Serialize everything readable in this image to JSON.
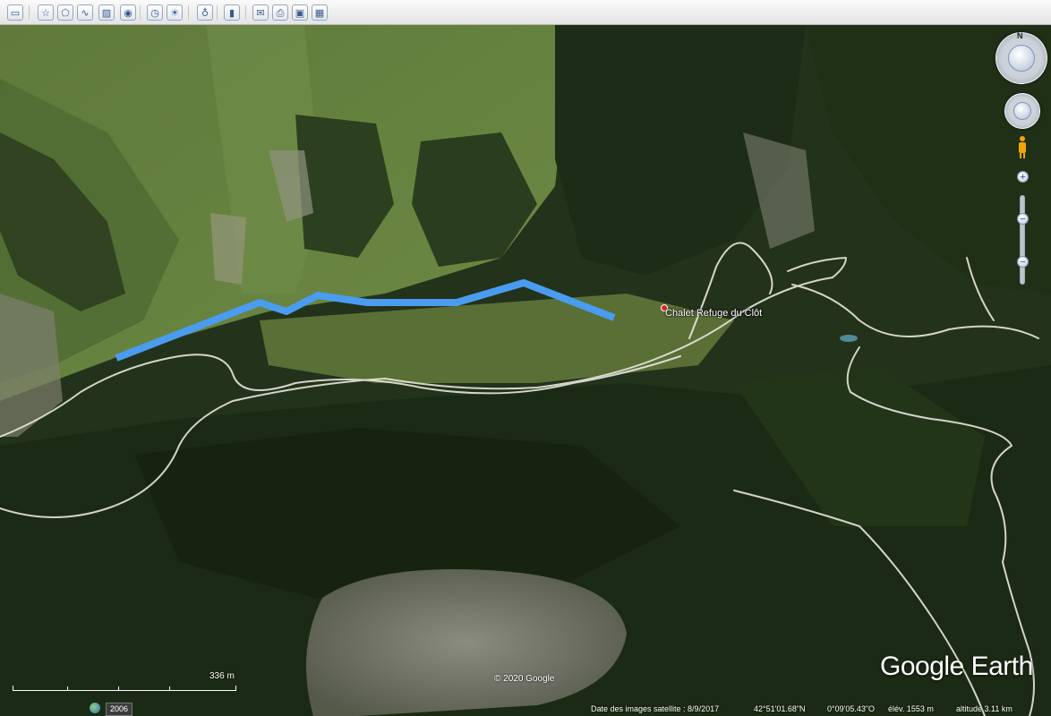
{
  "toolbar": {
    "buttons": [
      {
        "name": "sidebar-toggle-icon",
        "glyph": "▭"
      },
      {
        "name": "add-placemark-icon",
        "glyph": "☆"
      },
      {
        "name": "add-polygon-icon",
        "glyph": "⬠"
      },
      {
        "name": "add-path-icon",
        "glyph": "∿"
      },
      {
        "name": "add-image-overlay-icon",
        "glyph": "▨"
      },
      {
        "name": "record-tour-icon",
        "glyph": "◉"
      },
      {
        "name": "historical-imagery-icon",
        "glyph": "◷"
      },
      {
        "name": "sunlight-icon",
        "glyph": "☀"
      },
      {
        "name": "switch-to-sky-icon",
        "glyph": "♁"
      },
      {
        "name": "ruler-icon",
        "glyph": "▮"
      },
      {
        "name": "email-icon",
        "glyph": "✉"
      },
      {
        "name": "print-icon",
        "glyph": "⎙"
      },
      {
        "name": "save-image-icon",
        "glyph": "▣"
      },
      {
        "name": "view-in-maps-icon",
        "glyph": "▦"
      }
    ]
  },
  "map": {
    "place_label": "Chalet Refuge du Clôt",
    "copyright": "© 2020 Google",
    "logo": "Google Earth",
    "scale_label": "336  m",
    "route_color": "#4a9cf0"
  },
  "navigation": {
    "north_label": "N"
  },
  "status": {
    "year": "2006",
    "imagery_date": "Date des images satellite : 8/9/2017",
    "latitude": "42°51'01.68\"N",
    "longitude": "0°09'05.43\"O",
    "elevation": "élév.  1553 m",
    "altitude": "altitude   3.11 km"
  }
}
